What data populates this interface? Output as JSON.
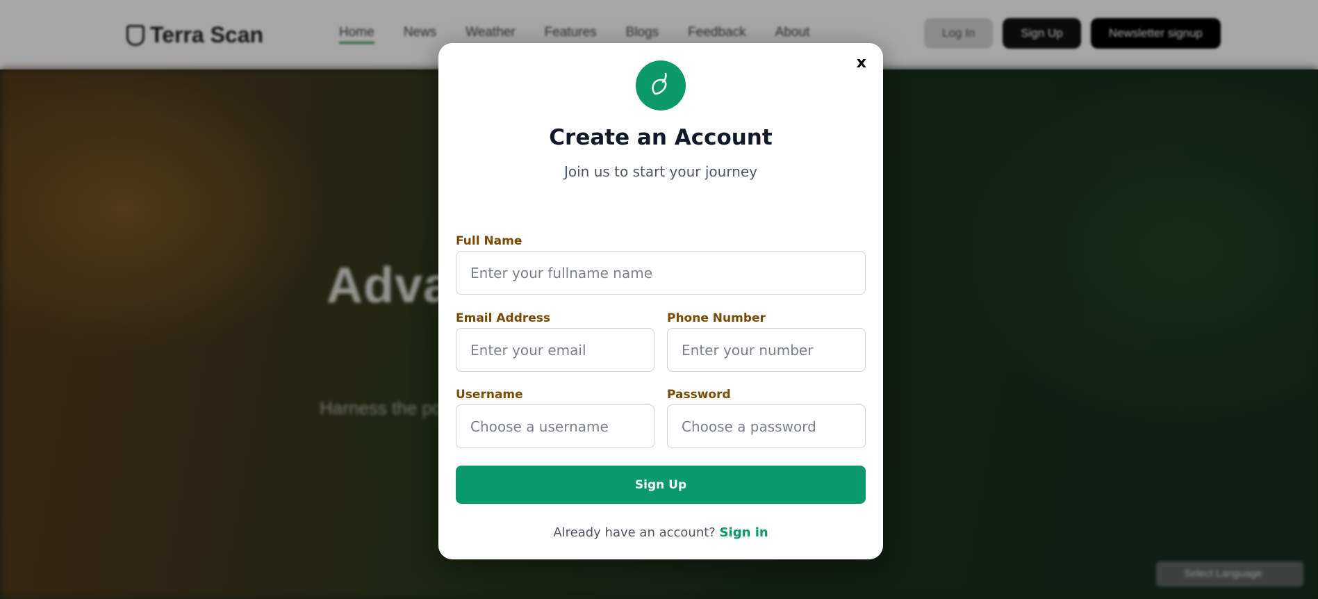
{
  "background": {
    "brand": "Terra Scan",
    "nav": [
      "Home",
      "News",
      "Weather",
      "Features",
      "Blogs",
      "Feedback",
      "About"
    ],
    "actions": [
      "Log In",
      "Sign Up",
      "Newsletter signup"
    ],
    "hero_title": "Advanced Analysis for",
    "hero_subtitle": "Harness the power of AI to analyze soil composition and",
    "language_widget": "Select Language",
    "colors": {
      "nav_active_underline": "#3a9a5a"
    }
  },
  "modal": {
    "close_label": "x",
    "brand_icon": "leaf-icon",
    "title": "Create an Account",
    "subtitle": "Join us to start your journey",
    "fields": {
      "full_name": {
        "label": "Full Name",
        "placeholder": "Enter your fullname name",
        "value": ""
      },
      "email": {
        "label": "Email Address",
        "placeholder": "Enter your email",
        "value": ""
      },
      "phone": {
        "label": "Phone Number",
        "placeholder": "Enter your number",
        "value": ""
      },
      "username": {
        "label": "Username",
        "placeholder": "Choose a username",
        "value": ""
      },
      "password": {
        "label": "Password",
        "placeholder": "Choose a password",
        "value": ""
      }
    },
    "submit_label": "Sign Up",
    "footer_prompt": "Already have an account?",
    "footer_link": "Sign in"
  },
  "colors": {
    "accent": "#089a6b",
    "label_color": "#7a4a00",
    "title_color": "#111827"
  }
}
